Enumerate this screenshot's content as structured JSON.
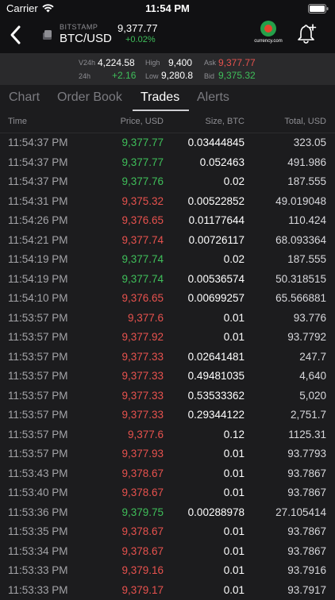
{
  "status": {
    "carrier": "Carrier",
    "time": "11:54 PM"
  },
  "header": {
    "exchange": "BITSTAMP",
    "pair": "BTC/USD",
    "last_price": "9,377.77",
    "change": "+0.02%",
    "brand": "currency.com"
  },
  "stats": {
    "v24h_label": "V24h",
    "v24h_value": "4,224.58",
    "h24_label": "24h",
    "h24_value": "+2.16",
    "high_label": "High",
    "high_value": "9,400",
    "low_label": "Low",
    "low_value": "9,280.8",
    "ask_label": "Ask",
    "ask_value": "9,377.77",
    "bid_label": "Bid",
    "bid_value": "9,375.32"
  },
  "tabs": [
    {
      "label": "Chart"
    },
    {
      "label": "Order Book"
    },
    {
      "label": "Trades"
    },
    {
      "label": "Alerts"
    }
  ],
  "columns": {
    "time": "Time",
    "price": "Price, USD",
    "size": "Size, BTC",
    "total": "Total, USD"
  },
  "colors": {
    "buy": "#3fbf5a",
    "sell": "#e8524e",
    "background": "#1c1c1e"
  },
  "trades": [
    {
      "time": "11:54:37 PM",
      "price": "9,377.77",
      "size": "0.03444845",
      "total": "323.05",
      "side": "buy"
    },
    {
      "time": "11:54:37 PM",
      "price": "9,377.77",
      "size": "0.052463",
      "total": "491.986",
      "side": "buy"
    },
    {
      "time": "11:54:37 PM",
      "price": "9,377.76",
      "size": "0.02",
      "total": "187.555",
      "side": "buy"
    },
    {
      "time": "11:54:31 PM",
      "price": "9,375.32",
      "size": "0.00522852",
      "total": "49.019048",
      "side": "sell"
    },
    {
      "time": "11:54:26 PM",
      "price": "9,376.65",
      "size": "0.01177644",
      "total": "110.424",
      "side": "sell"
    },
    {
      "time": "11:54:21 PM",
      "price": "9,377.74",
      "size": "0.00726117",
      "total": "68.093364",
      "side": "sell"
    },
    {
      "time": "11:54:19 PM",
      "price": "9,377.74",
      "size": "0.02",
      "total": "187.555",
      "side": "buy"
    },
    {
      "time": "11:54:19 PM",
      "price": "9,377.74",
      "size": "0.00536574",
      "total": "50.318515",
      "side": "buy"
    },
    {
      "time": "11:54:10 PM",
      "price": "9,376.65",
      "size": "0.00699257",
      "total": "65.566881",
      "side": "sell"
    },
    {
      "time": "11:53:57 PM",
      "price": "9,377.6",
      "size": "0.01",
      "total": "93.776",
      "side": "sell"
    },
    {
      "time": "11:53:57 PM",
      "price": "9,377.92",
      "size": "0.01",
      "total": "93.7792",
      "side": "sell"
    },
    {
      "time": "11:53:57 PM",
      "price": "9,377.33",
      "size": "0.02641481",
      "total": "247.7",
      "side": "sell"
    },
    {
      "time": "11:53:57 PM",
      "price": "9,377.33",
      "size": "0.49481035",
      "total": "4,640",
      "side": "sell"
    },
    {
      "time": "11:53:57 PM",
      "price": "9,377.33",
      "size": "0.53533362",
      "total": "5,020",
      "side": "sell"
    },
    {
      "time": "11:53:57 PM",
      "price": "9,377.33",
      "size": "0.29344122",
      "total": "2,751.7",
      "side": "sell"
    },
    {
      "time": "11:53:57 PM",
      "price": "9,377.6",
      "size": "0.12",
      "total": "1125.31",
      "side": "sell"
    },
    {
      "time": "11:53:57 PM",
      "price": "9,377.93",
      "size": "0.01",
      "total": "93.7793",
      "side": "sell"
    },
    {
      "time": "11:53:43 PM",
      "price": "9,378.67",
      "size": "0.01",
      "total": "93.7867",
      "side": "sell"
    },
    {
      "time": "11:53:40 PM",
      "price": "9,378.67",
      "size": "0.01",
      "total": "93.7867",
      "side": "sell"
    },
    {
      "time": "11:53:36 PM",
      "price": "9,379.75",
      "size": "0.00288978",
      "total": "27.105414",
      "side": "buy"
    },
    {
      "time": "11:53:35 PM",
      "price": "9,378.67",
      "size": "0.01",
      "total": "93.7867",
      "side": "sell"
    },
    {
      "time": "11:53:34 PM",
      "price": "9,378.67",
      "size": "0.01",
      "total": "93.7867",
      "side": "sell"
    },
    {
      "time": "11:53:33 PM",
      "price": "9,379.16",
      "size": "0.01",
      "total": "93.7916",
      "side": "sell"
    },
    {
      "time": "11:53:33 PM",
      "price": "9,379.17",
      "size": "0.01",
      "total": "93.7917",
      "side": "sell"
    }
  ]
}
